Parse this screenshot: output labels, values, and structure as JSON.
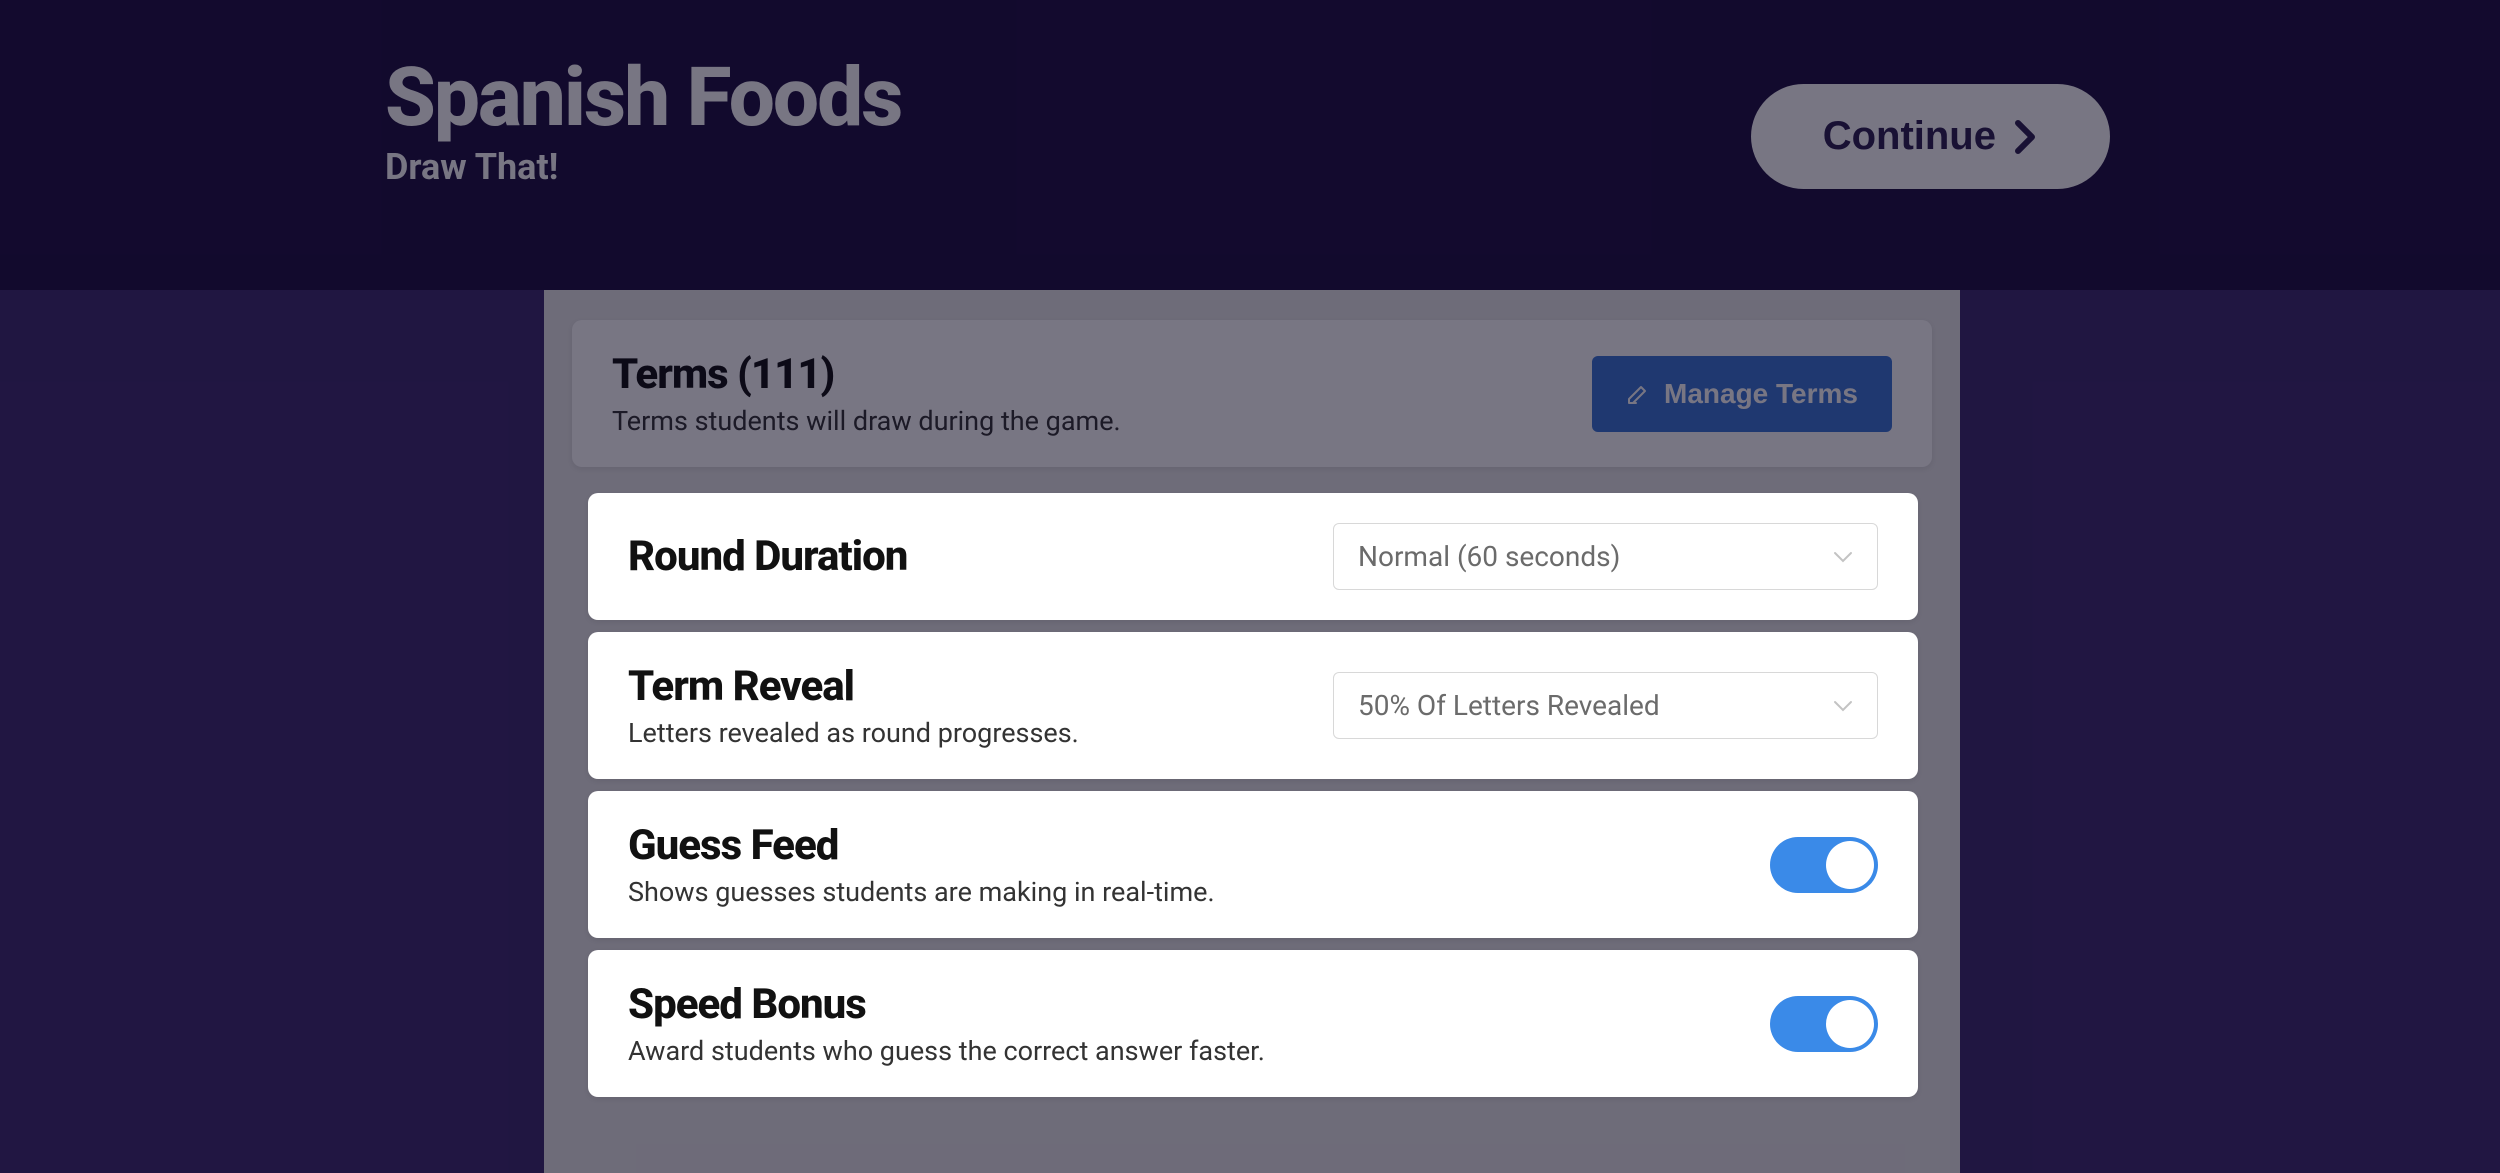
{
  "header": {
    "title": "Spanish Foods",
    "subtitle": "Draw That!",
    "continue_label": "Continue"
  },
  "terms_card": {
    "title": "Terms (111)",
    "desc": "Terms students will draw during the game.",
    "manage_label": "Manage Terms"
  },
  "settings": [
    {
      "title": "Round Duration",
      "desc": "",
      "control": "select",
      "value": "Normal (60 seconds)"
    },
    {
      "title": "Term Reveal",
      "desc": "Letters revealed as round progresses.",
      "control": "select",
      "value": "50% Of Letters Revealed"
    },
    {
      "title": "Guess Feed",
      "desc": "Shows guesses students are making in real-time.",
      "control": "toggle",
      "on": true
    },
    {
      "title": "Speed Bonus",
      "desc": "Award students who guess the correct answer faster.",
      "control": "toggle",
      "on": true
    }
  ]
}
